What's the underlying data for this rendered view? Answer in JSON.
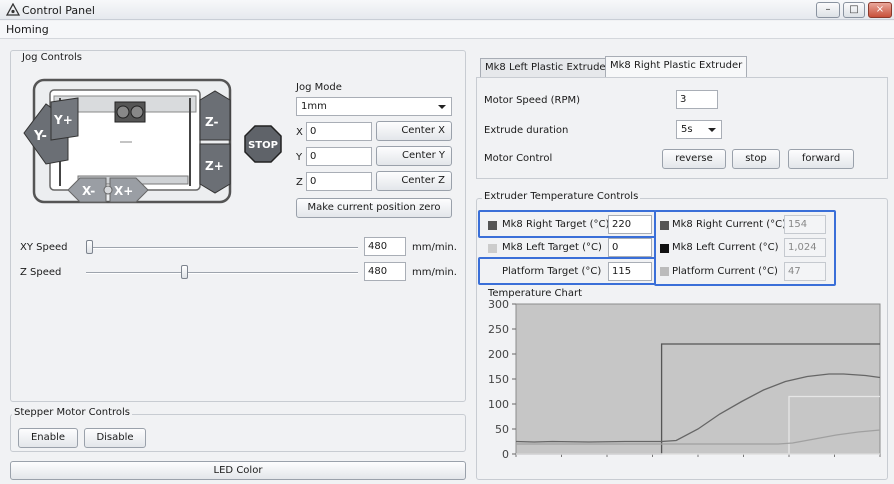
{
  "window": {
    "title": "Control Panel",
    "controls": {
      "minimize": "–",
      "maximize": "□",
      "close": "×"
    }
  },
  "menu": {
    "homing": "Homing"
  },
  "jog": {
    "group_title": "Jog Controls",
    "mode_label": "Jog Mode",
    "mode_value": "1mm",
    "x_label": "X",
    "x_value": "0",
    "center_x": "Center X",
    "y_label": "Y",
    "y_value": "0",
    "center_y": "Center Y",
    "z_label": "Z",
    "z_value": "0",
    "center_z": "Center Z",
    "make_zero": "Make current position zero",
    "buttons": {
      "y_minus": "Y-",
      "y_plus": "Y+",
      "x_minus": "X-",
      "x_plus": "X+",
      "z_minus": "Z-",
      "z_plus": "Z+",
      "stop": "STOP"
    },
    "xy_speed_label": "XY Speed",
    "xy_speed_value": "480",
    "xy_speed_unit": "mm/min.",
    "xy_slider_fraction": 0.0,
    "z_speed_label": "Z Speed",
    "z_speed_value": "480",
    "z_speed_unit": "mm/min.",
    "z_slider_fraction": 0.36
  },
  "stepper": {
    "title": "Stepper Motor Controls",
    "enable": "Enable",
    "disable": "Disable"
  },
  "led": {
    "label": "LED Color"
  },
  "extruder": {
    "tabs": [
      "Mk8 Left Plastic Extruder",
      "Mk8 Right Plastic Extruder"
    ],
    "active_tab": 1,
    "motor_speed_label": "Motor Speed (RPM)",
    "motor_speed_value": "3",
    "extrude_duration_label": "Extrude duration",
    "extrude_duration_value": "5s",
    "motor_control_label": "Motor Control",
    "reverse": "reverse",
    "stop": "stop",
    "forward": "forward"
  },
  "temps": {
    "group_title": "Extruder Temperature Controls",
    "right_target_label": "Mk8 Right Target (°C)",
    "right_target_value": "220",
    "left_target_label": "Mk8 Left Target (°C)",
    "left_target_value": "0",
    "platform_target_label": "Platform Target (°C)",
    "platform_target_value": "115",
    "right_current_label": "Mk8 Right Current (°C)",
    "right_current_value": "154",
    "left_current_label": "Mk8 Left Current (°C)",
    "left_current_value": "1,024",
    "platform_current_label": "Platform Current (°C)",
    "platform_current_value": "47",
    "colors": {
      "right": "#555555",
      "left_target": "#cccccc",
      "left_current": "#111111",
      "platform": "#bbbbbb"
    }
  },
  "chart_data": {
    "type": "line",
    "title": "Temperature Chart",
    "xlabel": "",
    "ylabel": "",
    "ylim": [
      0,
      300
    ],
    "xlim": [
      0,
      100
    ],
    "yticks": [
      "0",
      "50",
      "100",
      "150",
      "200",
      "250",
      "300"
    ],
    "background": "#c6c6c6",
    "series": [
      {
        "key": "right_target",
        "color": "#555555",
        "x": [
          0,
          40,
          40,
          100
        ],
        "y": [
          0,
          0,
          220,
          220
        ]
      },
      {
        "key": "right_current",
        "color": "#666666",
        "x": [
          0,
          5,
          10,
          20,
          30,
          40,
          44,
          50,
          56,
          62,
          68,
          74,
          80,
          86,
          90,
          96,
          100
        ],
        "y": [
          25,
          24,
          25,
          24,
          25,
          25,
          27,
          50,
          80,
          105,
          128,
          145,
          155,
          160,
          160,
          157,
          153
        ]
      },
      {
        "key": "platform_target",
        "color": "#e6e6e6",
        "x": [
          0,
          75,
          75,
          100
        ],
        "y": [
          0,
          0,
          115,
          115
        ]
      },
      {
        "key": "platform_current",
        "color": "#a0a0a0",
        "x": [
          0,
          72,
          76,
          82,
          88,
          94,
          100
        ],
        "y": [
          20,
          20,
          22,
          30,
          38,
          44,
          48
        ]
      },
      {
        "key": "left_target",
        "color": "#dddddd",
        "x": [
          0,
          100
        ],
        "y": [
          0,
          0
        ]
      }
    ]
  }
}
